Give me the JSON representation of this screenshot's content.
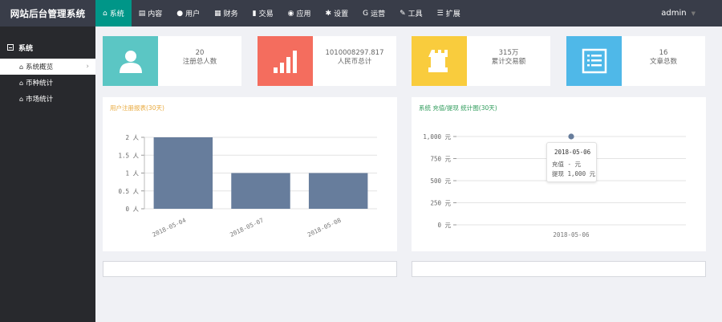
{
  "app": {
    "title": "网站后台管理系统"
  },
  "nav": [
    {
      "label": "系统",
      "icon": "home-icon",
      "active": true
    },
    {
      "label": "内容",
      "icon": "document-icon"
    },
    {
      "label": "用户",
      "icon": "user-icon"
    },
    {
      "label": "财务",
      "icon": "table-icon"
    },
    {
      "label": "交易",
      "icon": "bar-chart-icon"
    },
    {
      "label": "应用",
      "icon": "globe-icon"
    },
    {
      "label": "设置",
      "icon": "gear-icon"
    },
    {
      "label": "运营",
      "icon": "google-icon"
    },
    {
      "label": "工具",
      "icon": "wrench-icon"
    },
    {
      "label": "扩展",
      "icon": "server-icon"
    }
  ],
  "user": {
    "name": "admin"
  },
  "sidebar": {
    "section": "系统",
    "items": [
      {
        "label": "系统概览",
        "active": true
      },
      {
        "label": "币种统计"
      },
      {
        "label": "市场统计"
      }
    ]
  },
  "stats": [
    {
      "value": "20",
      "label": "注册总人数",
      "color": "#5bc6c4",
      "icon": "user-icon"
    },
    {
      "value": "1010008297.817",
      "label": "人民币总计",
      "color": "#f46d5e",
      "icon": "signal-bars-icon"
    },
    {
      "value": "315万",
      "label": "累计交易额",
      "color": "#f9cc3d",
      "icon": "rook-icon"
    },
    {
      "value": "16",
      "label": "文章总数",
      "color": "#4fb8e8",
      "icon": "list-icon"
    }
  ],
  "chart_data": [
    {
      "type": "bar",
      "title": "用户注册报表(30天)",
      "title_color": "#e8a93d",
      "categories": [
        "2018-05-04",
        "2018-05-07",
        "2018-05-08"
      ],
      "values": [
        2,
        1,
        1
      ],
      "ylim": [
        0,
        2
      ],
      "yticks": [
        0,
        0.5,
        1,
        1.5,
        2
      ],
      "ytick_labels": [
        "0 人",
        "0.5 人",
        "1 人",
        "1.5 人",
        "2 人"
      ],
      "bar_color": "#677d9c",
      "grid": true
    },
    {
      "type": "line",
      "title": "系统 充值/提现 统计图(30天)",
      "title_color": "#2e9b5a",
      "categories": [
        "2018-05-06"
      ],
      "series": [
        {
          "name": "充值",
          "values": [
            null
          ]
        },
        {
          "name": "提现",
          "values": [
            1000
          ]
        }
      ],
      "ylim": [
        0,
        1000
      ],
      "yticks": [
        0,
        250,
        500,
        750,
        1000
      ],
      "ytick_labels": [
        "0 元",
        "250 元",
        "500 元",
        "750 元",
        "1,000 元"
      ],
      "point_color": "#677d9c",
      "grid": true,
      "tooltip": {
        "date": "2018-05-06",
        "rows": [
          "充值  - 元",
          "提现  1,000 元"
        ]
      }
    }
  ]
}
